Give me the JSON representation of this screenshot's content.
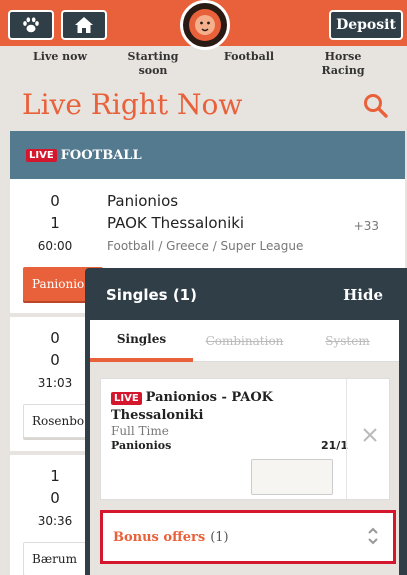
{
  "header": {
    "paw_icon": "paw-icon",
    "home_icon": "home-icon",
    "logo_icon": "lion-logo-icon",
    "deposit_label": "Deposit"
  },
  "nav": {
    "items": [
      {
        "label": "Live now"
      },
      {
        "label": "Starting\nsoon"
      },
      {
        "label": "Football"
      },
      {
        "label": "Horse\nRacing"
      }
    ]
  },
  "page": {
    "title": "Live Right Now",
    "search_icon": "search-icon"
  },
  "sport": {
    "live_badge": "LIVE",
    "name": "FOOTBALL"
  },
  "events": [
    {
      "home_score": "0",
      "away_score": "1",
      "clock": "60:00",
      "home": "Panionios",
      "away": "PAOK Thessaloniki",
      "league": "Football / Greece / Super League",
      "more_markets": "+33",
      "odd_label": "Panionios"
    },
    {
      "home_score": "0",
      "away_score": "0",
      "clock": "31:03",
      "odd_label": "Rosenbo"
    },
    {
      "home_score": "1",
      "away_score": "0",
      "clock": "30:36",
      "odd_label": "Bærum"
    }
  ],
  "slip": {
    "title": "Singles (1)",
    "hide_label": "Hide",
    "tabs": [
      {
        "label": "Singles",
        "state": "active"
      },
      {
        "label": "Combination",
        "state": "disabled"
      },
      {
        "label": "System",
        "state": "disabled"
      }
    ],
    "bet": {
      "live_badge": "LIVE",
      "match": "Panionios - PAOK Thessaloniki",
      "market": "Full Time",
      "selection": "Panionios",
      "odds": "21/1",
      "stake_value": "",
      "remove_icon": "close-icon"
    },
    "bonus": {
      "label": "Bonus offers",
      "count": "(1)",
      "chevron_icon": "up-down-chevron-icon"
    }
  },
  "colors": {
    "accent": "#e8613a",
    "dark": "#2f3e47",
    "sport_header": "#537a8e",
    "live_red": "#d4172d",
    "background": "#e7e3df"
  }
}
